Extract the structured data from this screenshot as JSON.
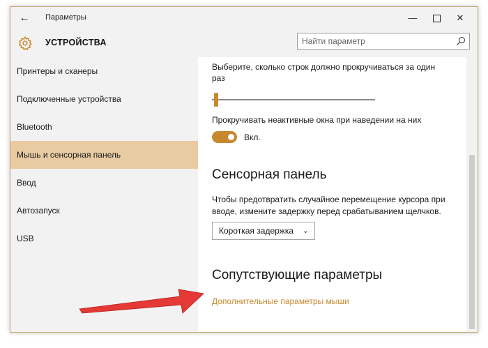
{
  "window": {
    "title": "Параметры",
    "back_icon": "arrow-left-icon",
    "controls": {
      "minimize": "—",
      "close": "✕"
    }
  },
  "header": {
    "icon": "gear-icon",
    "title": "УСТРОЙСТВА",
    "search_placeholder": "Найти параметр"
  },
  "sidebar": {
    "items": [
      {
        "label": "Принтеры и сканеры",
        "active": false
      },
      {
        "label": "Подключенные устройства",
        "active": false
      },
      {
        "label": "Bluetooth",
        "active": false
      },
      {
        "label": "Мышь и сенсорная панель",
        "active": true
      },
      {
        "label": "Ввод",
        "active": false
      },
      {
        "label": "Автозапуск",
        "active": false
      },
      {
        "label": "USB",
        "active": false
      }
    ]
  },
  "content": {
    "lines_label_1": "Выберите, сколько строк должно прокручиваться за один",
    "lines_label_2": "раз",
    "lines_slider_level": 0.01,
    "inactive_scroll_label": "Прокручивать неактивные окна при наведении на них",
    "inactive_scroll_toggle": {
      "state": "on",
      "text": "Вкл."
    },
    "touchpad": {
      "heading": "Сенсорная панель",
      "desc_1": "Чтобы предотвратить случайное перемещение курсора при",
      "desc_2": "вводе, измените задержку перед срабатыванием щелчков.",
      "delay_selected": "Короткая задержка"
    },
    "related": {
      "heading": "Сопутствующие параметры",
      "link": "Дополнительные параметры мыши"
    }
  },
  "colors": {
    "accent": "#c7892d",
    "active_nav": "#e8cba3",
    "annotation_arrow": "#e53935"
  }
}
